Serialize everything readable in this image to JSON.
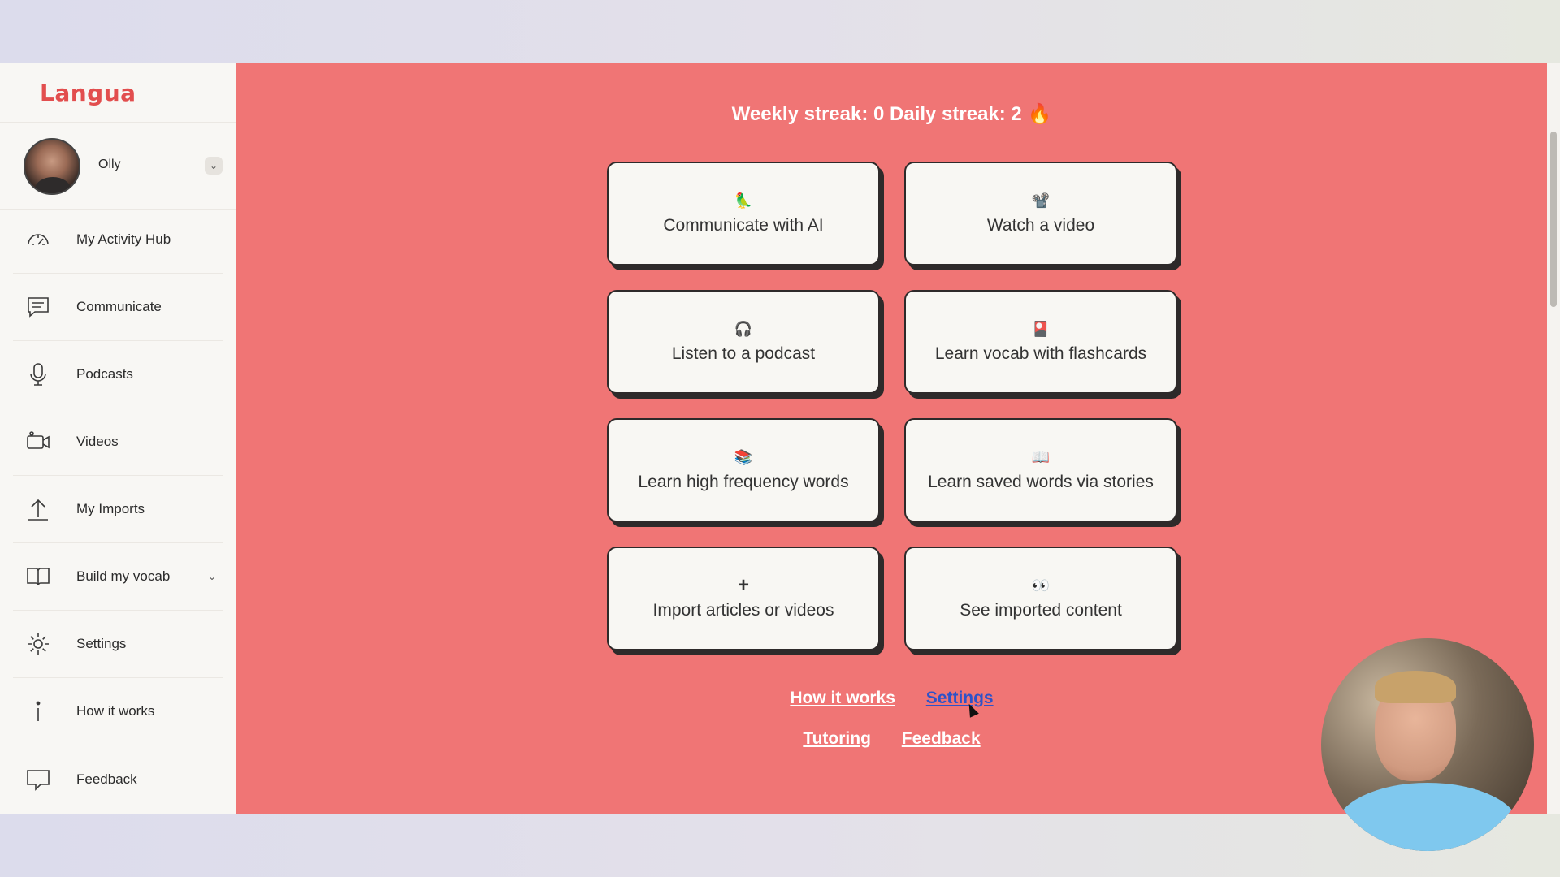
{
  "app": {
    "logo": "Langua",
    "accent_color": "#f07575",
    "logo_color": "#e24e4e"
  },
  "profile": {
    "name": "Olly",
    "chevron_icon": "chevron-down-icon"
  },
  "sidebar": {
    "items": [
      {
        "label": "My Activity Hub",
        "icon": "gauge-icon"
      },
      {
        "label": "Communicate",
        "icon": "chat-icon"
      },
      {
        "label": "Podcasts",
        "icon": "microphone-icon"
      },
      {
        "label": "Videos",
        "icon": "video-camera-icon"
      },
      {
        "label": "My Imports",
        "icon": "upload-icon"
      },
      {
        "label": "Build my vocab",
        "icon": "book-icon",
        "caret": "⌄"
      },
      {
        "label": "Settings",
        "icon": "gear-icon"
      },
      {
        "label": "How it works",
        "icon": "info-icon"
      },
      {
        "label": "Feedback",
        "icon": "feedback-icon"
      }
    ]
  },
  "main": {
    "streak_text": "Weekly streak: 0  Daily streak: 2 🔥",
    "cards": [
      {
        "icon": "🦜",
        "label": "Communicate with AI"
      },
      {
        "icon": "📽️",
        "label": "Watch a video"
      },
      {
        "icon": "🎧",
        "label": "Listen to a podcast"
      },
      {
        "icon": "🎴",
        "label": "Learn vocab with flashcards"
      },
      {
        "icon": "📚",
        "label": "Learn high frequency words"
      },
      {
        "icon": "📖",
        "label": "Learn saved words via stories"
      },
      {
        "icon": "+",
        "label": "Import articles or videos"
      },
      {
        "icon": "👀",
        "label": "See imported content"
      }
    ],
    "footer_links": {
      "how_it_works": "How it works",
      "settings": "Settings",
      "tutoring": "Tutoring",
      "feedback": "Feedback"
    }
  }
}
